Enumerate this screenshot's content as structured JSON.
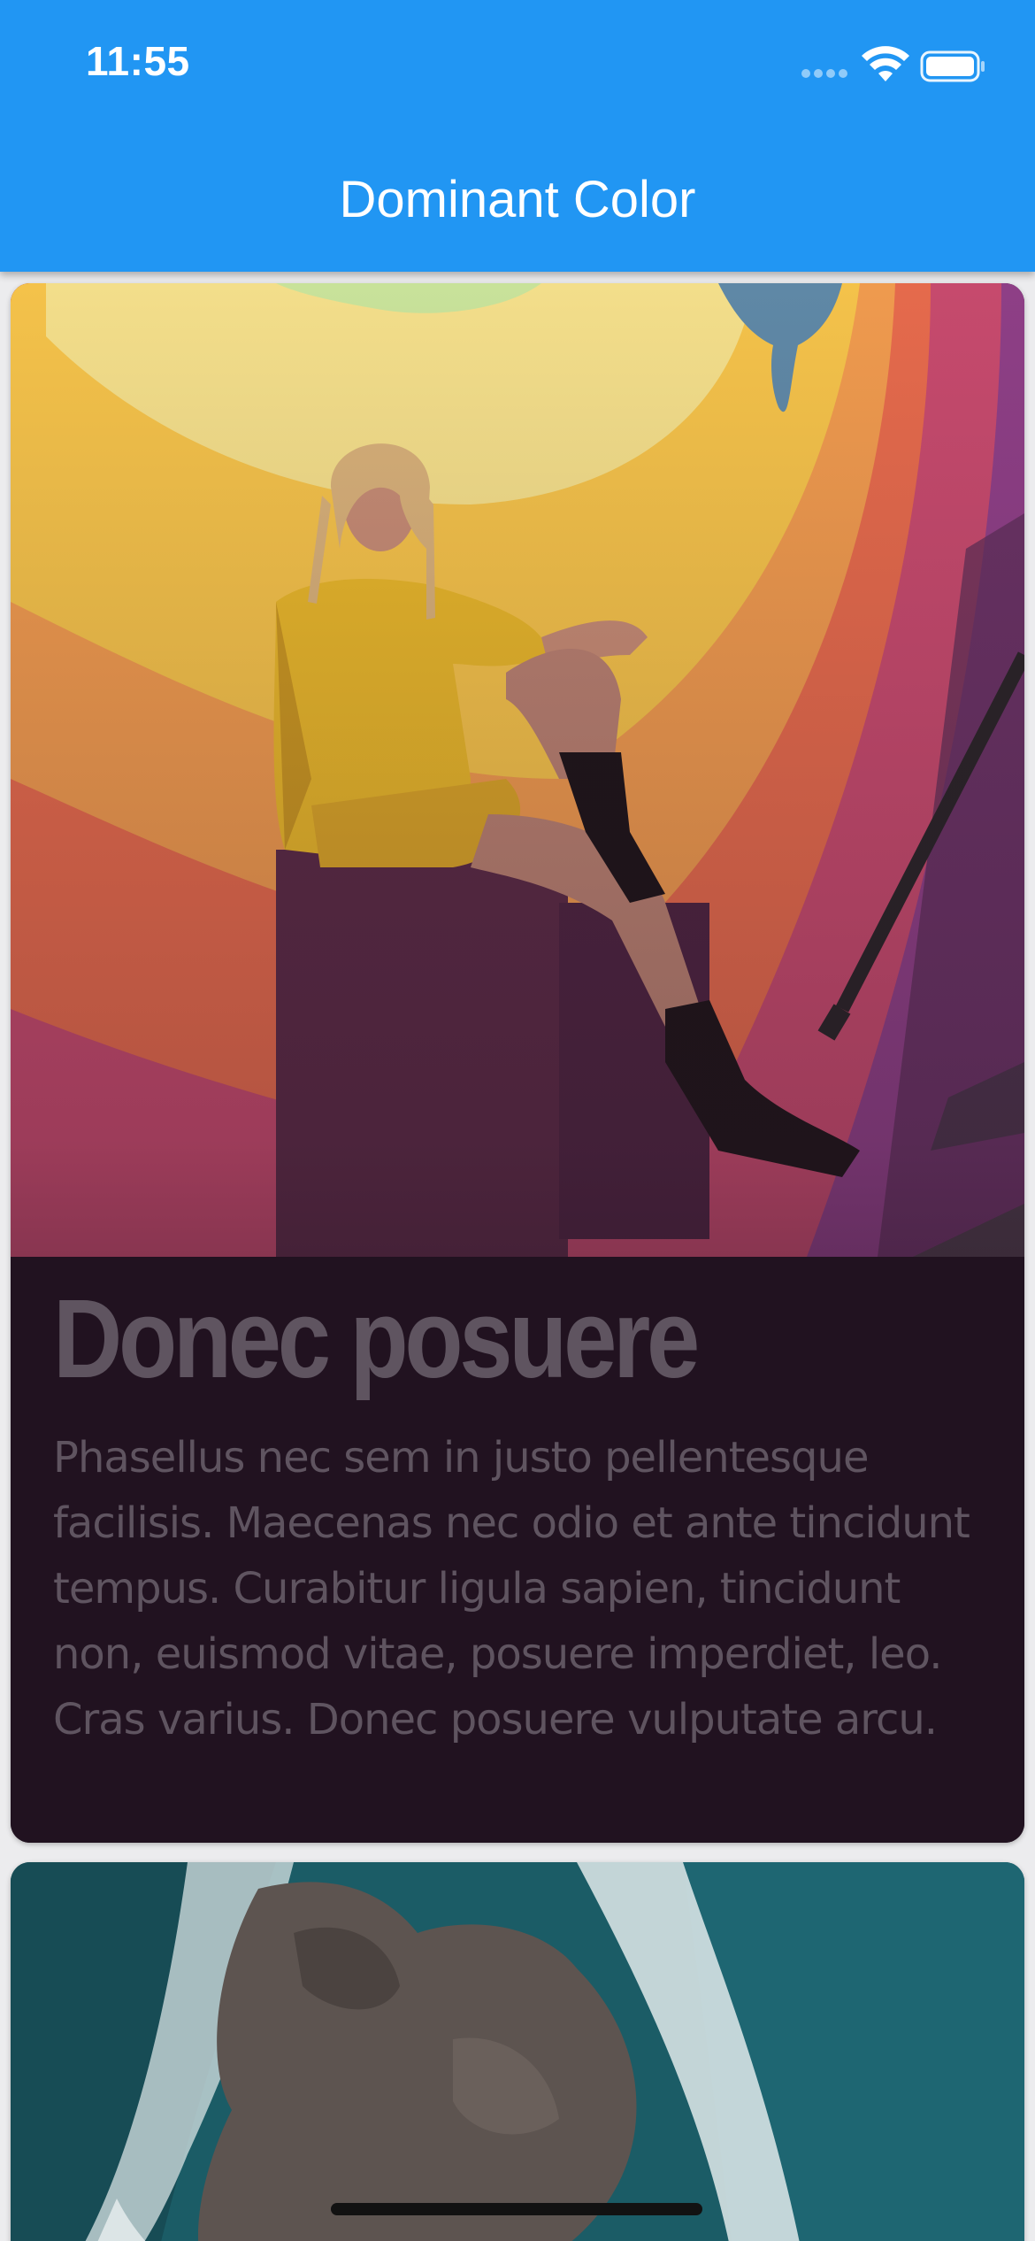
{
  "status_bar": {
    "time": "11:55"
  },
  "app_bar": {
    "title": "Dominant Color",
    "color": "#2196f3"
  },
  "cards": [
    {
      "title": "Donec posuere",
      "body": "Phasellus nec sem in justo pellentesque facilisis. Maecenas nec odio et ante tincidunt tempus. Curabitur ligula sapien, tincidunt non, euismod vitae, posuere imperdiet, leo. Cras varius. Donec posuere vulputate arcu.",
      "dominant_color": "#211220",
      "text_color": "#5f5460",
      "image": "woman-sitting-mural-photo"
    },
    {
      "image": "aerial-ocean-rock-photo",
      "dominant_color": "#1b5c66"
    }
  ]
}
